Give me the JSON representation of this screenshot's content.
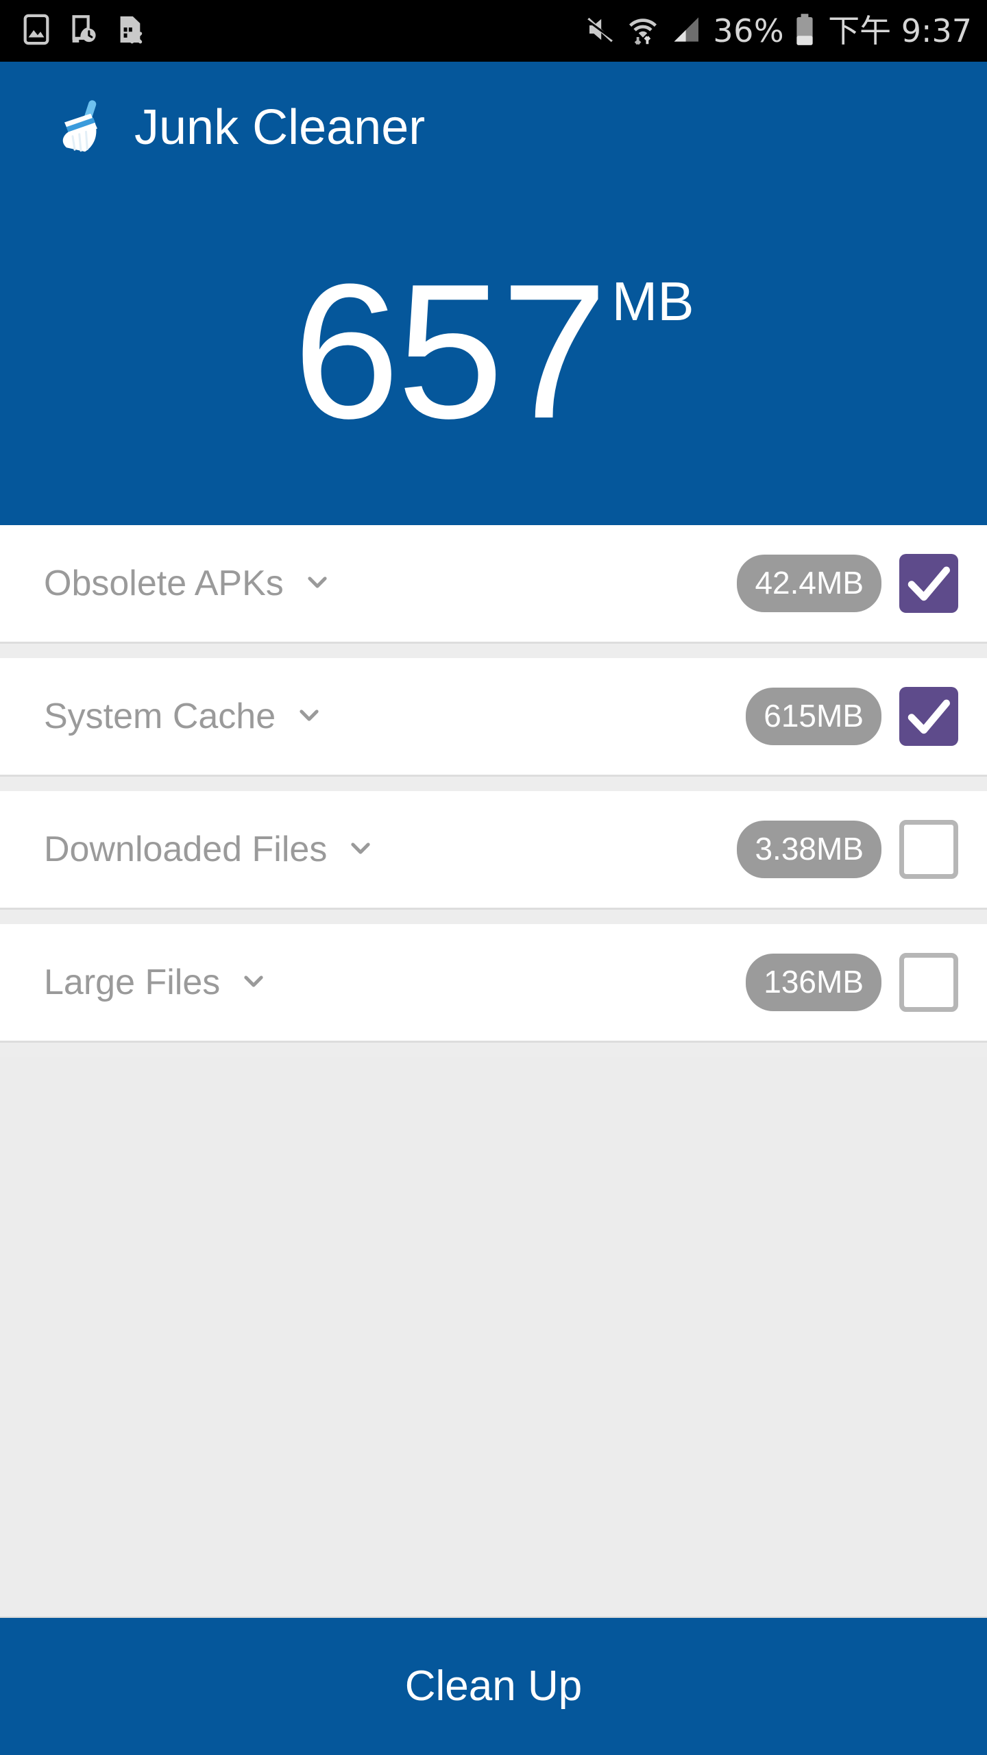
{
  "status_bar": {
    "left_icons": [
      "screenshot-image-icon",
      "device-clock-icon",
      "sim-card-error-icon"
    ],
    "right_icons": [
      "mute-icon",
      "wifi-data-transfer-icon",
      "signal-bars-icon",
      "battery-icon"
    ],
    "battery_percent": "36%",
    "clock": "下午 9:37"
  },
  "header": {
    "icon": "broom-icon",
    "title": "Junk Cleaner",
    "total_size": "657",
    "total_unit": "MB",
    "background_color": "#05579B"
  },
  "list": {
    "chevron_icon": "chevron-down-icon",
    "check_icon": "check-icon",
    "checked_color": "#5E4B8B",
    "badge_color": "#9B9B9B",
    "rows": [
      {
        "label": "Obsolete APKs",
        "size": "42.4MB",
        "checked": true
      },
      {
        "label": "System Cache",
        "size": "615MB",
        "checked": true
      },
      {
        "label": "Downloaded Files",
        "size": "3.38MB",
        "checked": false
      },
      {
        "label": "Large Files",
        "size": "136MB",
        "checked": false
      }
    ]
  },
  "footer": {
    "clean_up_label": "Clean Up",
    "background_color": "#05579B"
  }
}
